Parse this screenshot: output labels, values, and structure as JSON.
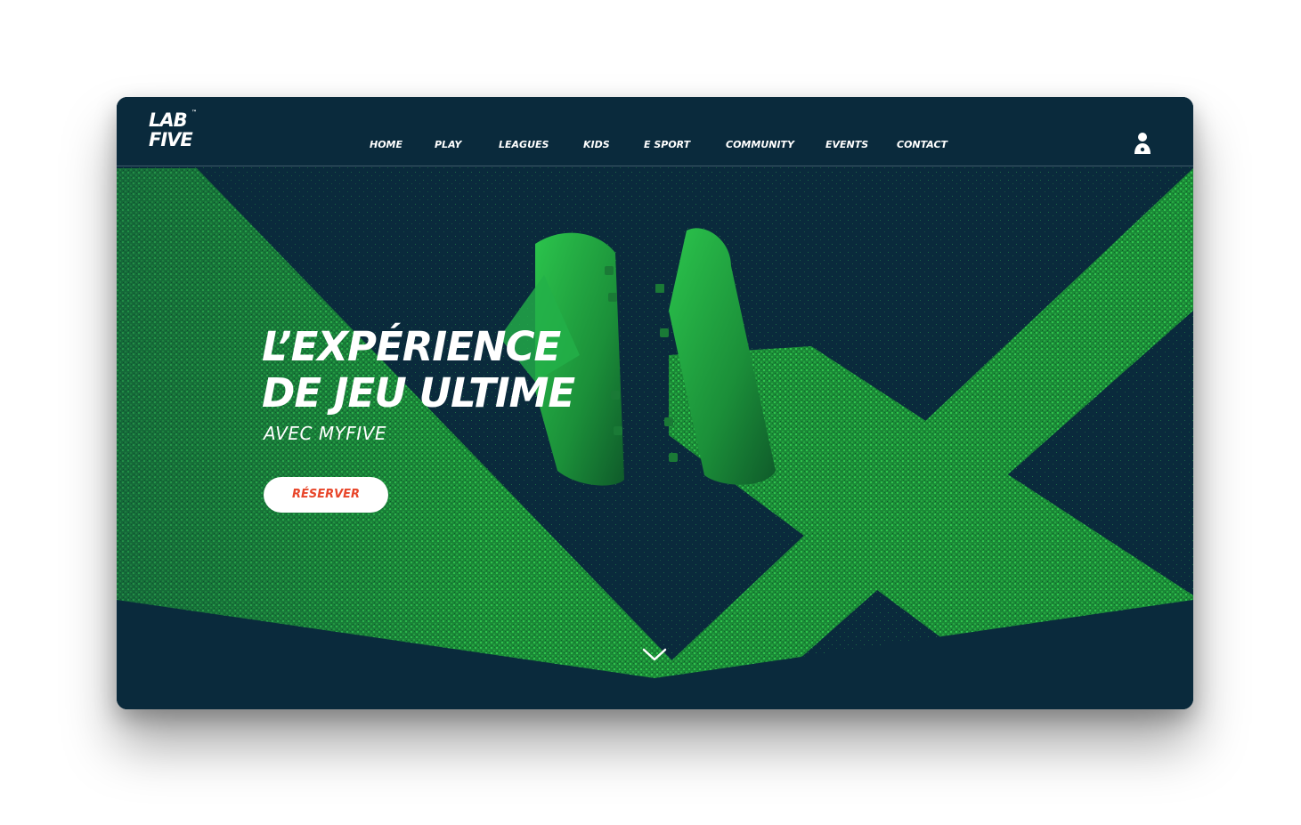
{
  "brand": {
    "logo_line1": "LAB",
    "logo_line2": "FIVE",
    "logo_mark": "™"
  },
  "nav": {
    "items": [
      {
        "label": "HOME"
      },
      {
        "label": "PLAY"
      },
      {
        "label": "LEAGUES"
      },
      {
        "label": "KIDS"
      },
      {
        "label": "E SPORT"
      },
      {
        "label": "COMMUNITY"
      },
      {
        "label": "EVENTS"
      },
      {
        "label": "CONTACT"
      }
    ],
    "user_icon": "user-account-icon"
  },
  "hero": {
    "headline_line1": "L’EXPÉRIENCE",
    "headline_line2": "DE JEU ULTIME",
    "subtitle": "AVEC MYFIVE",
    "cta_label": "RÉSERVER",
    "scroll_icon": "chevron-down-icon"
  },
  "colors": {
    "navy": "#0a2a3c",
    "grass_green": "#1f9a3e",
    "bright_green": "#2fc24d",
    "cta_text": "#e8462a",
    "white": "#ffffff"
  }
}
